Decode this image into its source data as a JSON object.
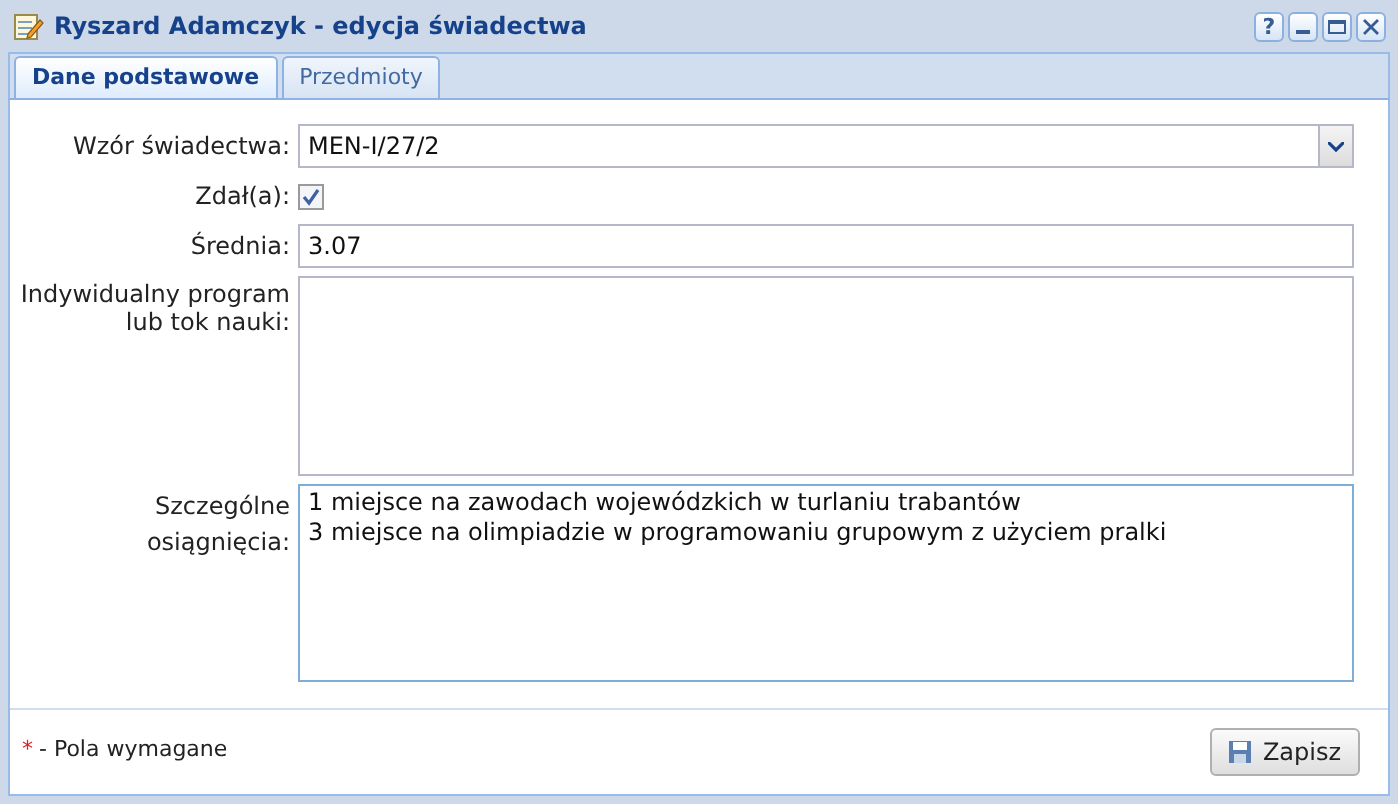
{
  "window": {
    "title": "Ryszard Adamczyk - edycja świadectwa",
    "buttons": [
      "?"
    ]
  },
  "tabs": [
    {
      "label": "Dane podstawowe",
      "selected": true
    },
    {
      "label": "Przedmioty",
      "selected": false
    }
  ],
  "form": {
    "template": {
      "label": "Wzór świadectwa:",
      "value": "MEN-I/27/2"
    },
    "passed": {
      "label": "Zdał(a):",
      "checked": true
    },
    "average": {
      "label": "Średnia:",
      "value": "3.07"
    },
    "program": {
      "label": "Indywidualny program lub tok nauki:"
    },
    "achievements": {
      "label": "Szczególne osiągnięcia:",
      "value": "1 miejsce na zawodach wojewódzkich w turlaniu trabantów\n3 miejsce na olimpiadzie w programowaniu grupowym z użyciem pralki"
    }
  },
  "footer": {
    "required_mark": "*",
    "required_note": "- Pola wymagane",
    "save_button": "Zapisz"
  }
}
